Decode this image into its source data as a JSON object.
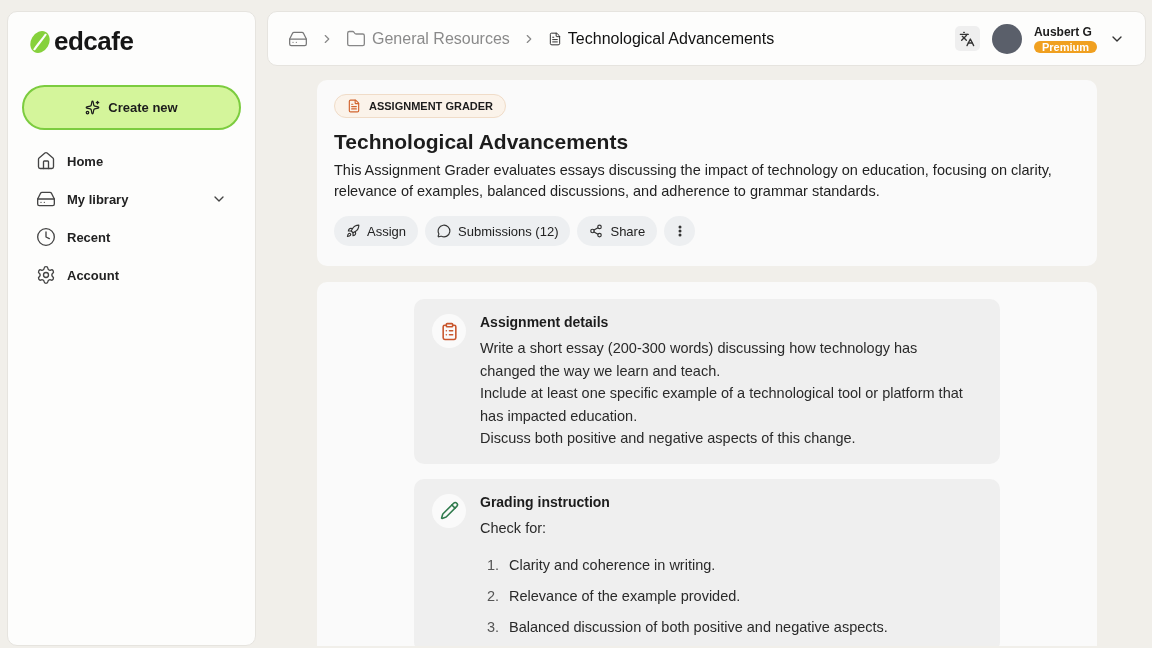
{
  "sidebar": {
    "logo": "edcafe",
    "create_button": "Create new",
    "items": [
      {
        "label": "Home",
        "expandable": false
      },
      {
        "label": "My library",
        "expandable": true
      },
      {
        "label": "Recent",
        "expandable": false
      },
      {
        "label": "Account",
        "expandable": false
      }
    ]
  },
  "breadcrumb": [
    {
      "label": "General Resources",
      "current": false
    },
    {
      "label": "Technological Advancements",
      "current": true
    }
  ],
  "user": {
    "name": "Ausbert G",
    "badge": "Premium"
  },
  "header": {
    "tag": "ASSIGNMENT GRADER",
    "title": "Technological Advancements",
    "description": "This Assignment Grader evaluates essays discussing the impact of technology on education, focusing on clarity, relevance of examples, balanced discussions, and adherence to grammar standards.",
    "actions": [
      {
        "label": "Assign"
      },
      {
        "label": "Submissions (12)"
      },
      {
        "label": "Share"
      }
    ]
  },
  "sections": [
    {
      "title": "Assignment details",
      "paragraphs": [
        "Write a short essay (200-300 words) discussing how technology has changed the way we learn and teach.",
        "Include at least one specific example of a technological tool or platform that has impacted education.",
        "Discuss both positive and negative aspects of this change."
      ]
    },
    {
      "title": "Grading instruction",
      "paragraphs": [
        "Check for:"
      ],
      "list": [
        {
          "number": "1.",
          "text": "Clarity and coherence in writing."
        },
        {
          "number": "2.",
          "text": "Relevance of the example provided."
        },
        {
          "number": "3.",
          "text": "Balanced discussion of both positive and negative aspects."
        }
      ]
    }
  ]
}
